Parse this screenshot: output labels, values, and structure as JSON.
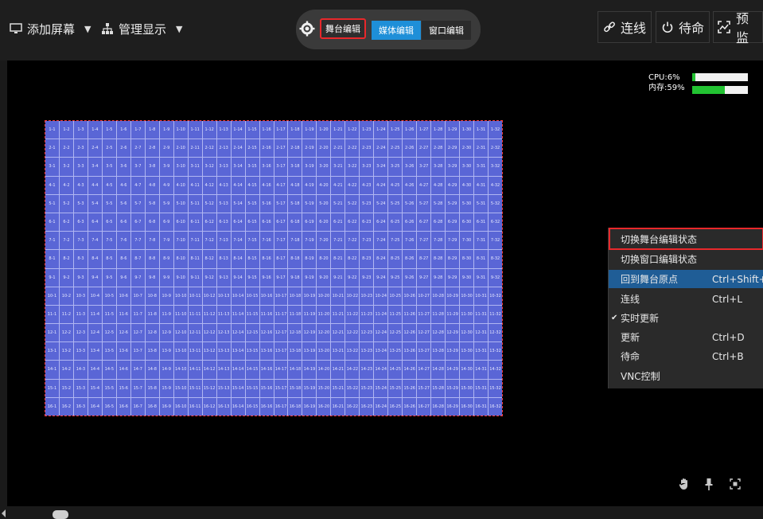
{
  "toolbar": {
    "add_screen": "添加屏幕",
    "manage_display": "管理显示",
    "stage_edit": "舞台编辑",
    "media_edit": "媒体编辑",
    "window_edit": "窗口编辑",
    "connect": "连线",
    "standby": "待命",
    "preview": "预监",
    "active_mode": "media_edit",
    "accent_color": "#1e8fd8",
    "highlight_color": "#e8282b"
  },
  "stats": {
    "cpu_label": "CPU:6%",
    "cpu_percent": 6,
    "mem_label": "内存:59%",
    "mem_percent": 59
  },
  "grid": {
    "rows": 16,
    "cols": 32,
    "cell_color": "#5a66d6",
    "line_color": "#b0b6f2",
    "border_color": "#ff3a3a"
  },
  "context_menu": {
    "items": [
      {
        "label": "切换舞台编辑状态",
        "shortcut": "",
        "highlighted": true
      },
      {
        "label": "切换窗口编辑状态",
        "shortcut": ""
      },
      {
        "label": "回到舞台原点",
        "shortcut": "Ctrl+Shift+",
        "selected": true
      },
      {
        "label": "连线",
        "shortcut": "Ctrl+L"
      },
      {
        "label": "实时更新",
        "shortcut": "",
        "checked": true
      },
      {
        "label": "更新",
        "shortcut": "Ctrl+D"
      },
      {
        "label": "待命",
        "shortcut": "Ctrl+B"
      },
      {
        "label": "VNC控制",
        "shortcut": ""
      }
    ]
  },
  "icons": {
    "add_screen": "monitor-icon",
    "manage_display": "network-icon",
    "settings": "gear-icon",
    "connect": "link-icon",
    "standby": "power-icon",
    "preview": "preview-icon",
    "hand": "hand-icon",
    "pin": "pin-icon",
    "fit": "fit-screen-icon"
  }
}
